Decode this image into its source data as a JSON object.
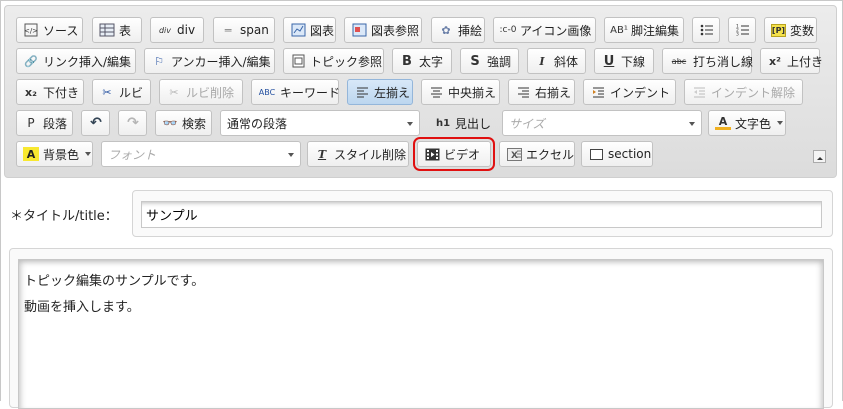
{
  "toolbar": {
    "row1": {
      "source": "ソース",
      "table": "表",
      "div": "div",
      "span": "span",
      "chart": "図表",
      "chart_ref": "図表参照",
      "illustration": "挿絵",
      "icon_image": "アイコン画像",
      "footnote": "脚注編集",
      "variable": "変数"
    },
    "row2": {
      "link": "リンク挿入/編集",
      "anchor": "アンカー挿入/編集",
      "topic_ref": "トピック参照",
      "bold": "太字",
      "strong": "強調",
      "italic": "斜体",
      "underline": "下線",
      "strike": "打ち消し線",
      "superscript": "上付き"
    },
    "row3": {
      "subscript": "下付き",
      "ruby": "ルビ",
      "ruby_delete": "ルビ削除",
      "keyword": "キーワード",
      "align_left": "左揃え",
      "align_center": "中央揃え",
      "align_right": "右揃え",
      "indent": "インデント",
      "outdent": "インデント解除"
    },
    "row4": {
      "paragraph": "段落",
      "search": "検索",
      "format_value": "通常の段落",
      "heading": "見出し",
      "size_placeholder": "サイズ",
      "text_color": "文字色"
    },
    "row5": {
      "bg_color": "背景色",
      "font_placeholder": "フォント",
      "remove_style": "スタイル削除",
      "video": "ビデオ",
      "excel": "エクセル",
      "section": "section"
    }
  },
  "form": {
    "title_label": "＊タイトル/title：",
    "title_value": "サンプル",
    "body_lines": [
      "トピック編集のサンプルです。",
      "動画を挿入します。"
    ]
  },
  "colors": {
    "highlight": "#e01010",
    "active_button": "#bcd6ef"
  }
}
